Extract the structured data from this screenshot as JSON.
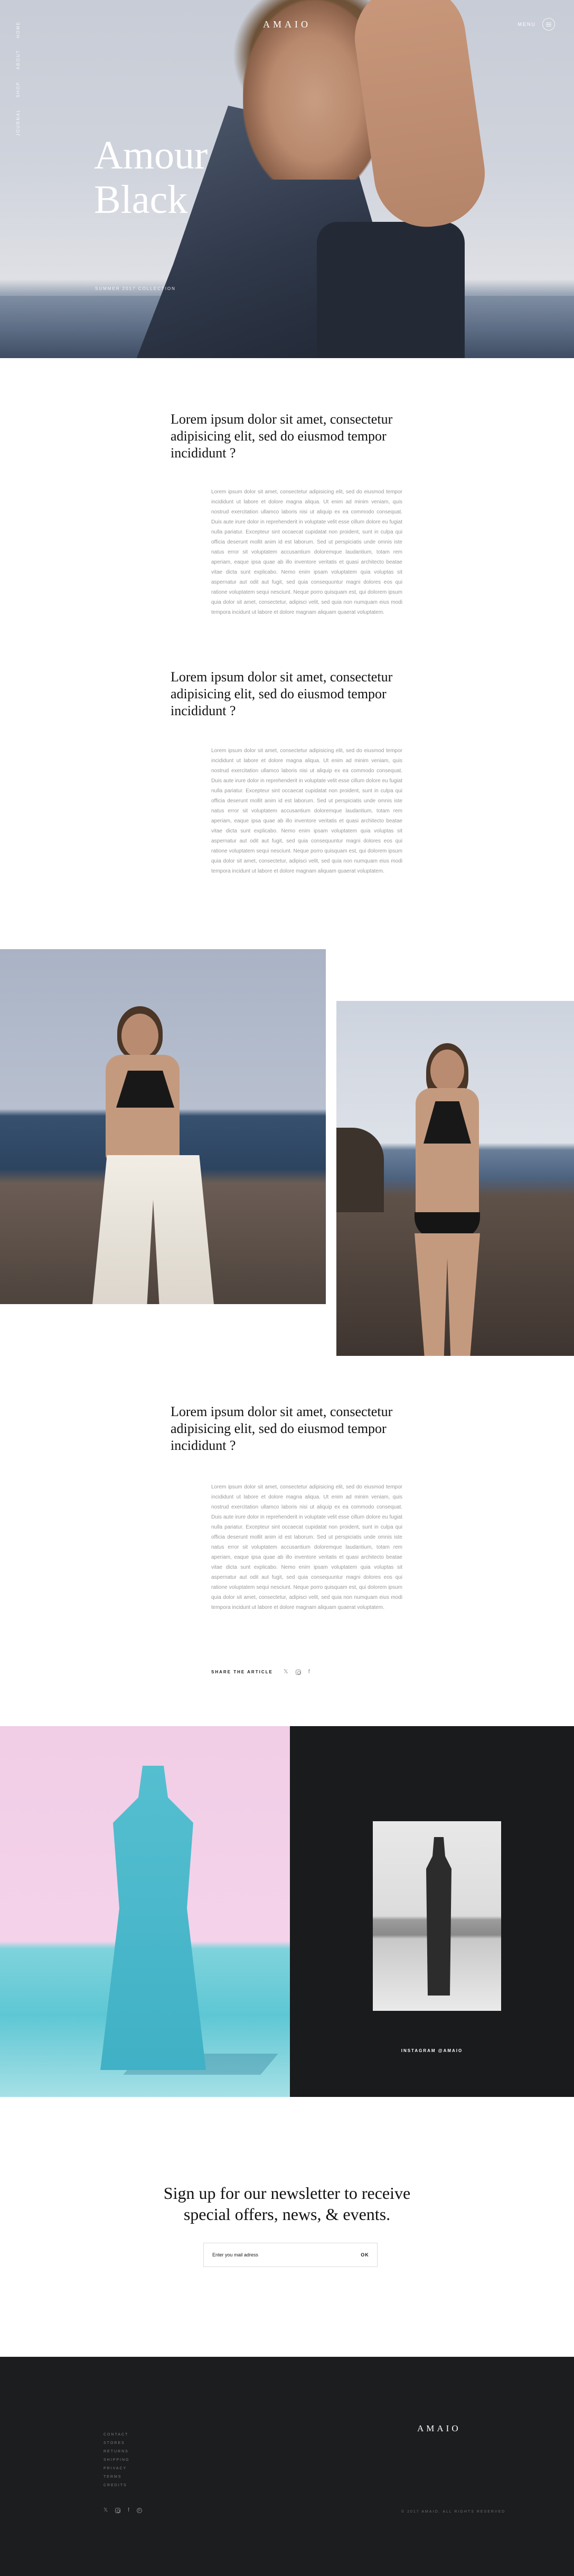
{
  "brand": "AMAIO",
  "header": {
    "menu_label": "MENU",
    "side_nav": [
      "HOME",
      "ABOUT",
      "SHOP",
      "JOURNAL"
    ]
  },
  "hero": {
    "title_line1": "Amour",
    "title_line2": "Black",
    "caption": "SUMMER 2017 COLLECTION"
  },
  "article": {
    "sections": [
      {
        "heading": "Lorem ipsum dolor sit amet, consectetur adipisicing elit, sed do eiusmod tempor incididunt ?",
        "body": "Lorem ipsum dolor sit amet, consectetur adipisicing elit, sed do eiusmod tempor incididunt ut labore et dolore magna aliqua. Ut enim ad minim veniam, quis nostrud exercitation ullamco laboris nisi ut aliquip ex ea commodo consequat. Duis aute irure dolor in reprehenderit in voluptate velit esse cillum dolore eu fugiat nulla pariatur. Excepteur sint occaecat cupidatat non proident, sunt in culpa qui officia deserunt mollit anim id est laborum. Sed ut perspiciatis unde omnis iste natus error sit voluptatem accusantium doloremque laudantium, totam rem aperiam, eaque ipsa quae ab illo inventore veritatis et quasi architecto beatae vitae dicta sunt explicabo. Nemo enim ipsam voluptatem quia voluptas sit aspernatur aut odit aut fugit, sed quia consequuntur magni dolores eos qui ratione voluptatem sequi nesciunt. Neque porro quisquam est, qui dolorem ipsum quia dolor sit amet, consectetur, adipisci velit, sed quia non numquam eius modi tempora incidunt ut labore et dolore magnam aliquam quaerat voluptatem."
      },
      {
        "heading": "Lorem ipsum dolor sit amet, consectetur adipisicing elit, sed do eiusmod tempor incididunt ?",
        "body": "Lorem ipsum dolor sit amet, consectetur adipisicing elit, sed do eiusmod tempor incididunt ut labore et dolore magna aliqua. Ut enim ad minim veniam, quis nostrud exercitation ullamco laboris nisi ut aliquip ex ea commodo consequat. Duis aute irure dolor in reprehenderit in voluptate velit esse cillum dolore eu fugiat nulla pariatur. Excepteur sint occaecat cupidatat non proident, sunt in culpa qui officia deserunt mollit anim id est laborum. Sed ut perspiciatis unde omnis iste natus error sit voluptatem accusantium doloremque laudantium, totam rem aperiam, eaque ipsa quae ab illo inventore veritatis et quasi architecto beatae vitae dicta sunt explicabo. Nemo enim ipsam voluptatem quia voluptas sit aspernatur aut odit aut fugit, sed quia consequuntur magni dolores eos qui ratione voluptatem sequi nesciunt. Neque porro quisquam est, qui dolorem ipsum quia dolor sit amet, consectetur, adipisci velit, sed quia non numquam eius modi tempora incidunt ut labore et dolore magnam aliquam quaerat voluptatem."
      },
      {
        "heading": "Lorem ipsum dolor sit amet, consectetur adipisicing elit, sed do eiusmod tempor incididunt ?",
        "body": "Lorem ipsum dolor sit amet, consectetur adipisicing elit, sed do eiusmod tempor incididunt ut labore et dolore magna aliqua. Ut enim ad minim veniam, quis nostrud exercitation ullamco laboris nisi ut aliquip ex ea commodo consequat. Duis aute irure dolor in reprehenderit in voluptate velit esse cillum dolore eu fugiat nulla pariatur. Excepteur sint occaecat cupidatat non proident, sunt in culpa qui officia deserunt mollit anim id est laborum. Sed ut perspiciatis unde omnis iste natus error sit voluptatem accusantium doloremque laudantium, totam rem aperiam, eaque ipsa quae ab illo inventore veritatis et quasi architecto beatae vitae dicta sunt explicabo. Nemo enim ipsam voluptatem quia voluptas sit aspernatur aut odit aut fugit, sed quia consequuntur magni dolores eos qui ratione voluptatem sequi nesciunt. Neque porro quisquam est, qui dolorem ipsum quia dolor sit amet, consectetur, adipisci velit, sed quia non numquam eius modi tempora incidunt ut labore et dolore magnam aliquam quaerat voluptatem."
      }
    ],
    "share_label": "SHARE THE ARTICLE",
    "share_icons": [
      "twitter-icon",
      "instagram-icon",
      "facebook-icon"
    ]
  },
  "feature": {
    "instagram_link": "INSTAGRAM @AMAIO"
  },
  "newsletter": {
    "heading_line1": "Sign up for our newsletter to receive",
    "heading_line2": "special offers, news, & events.",
    "placeholder": "Enter you mail adress",
    "submit_label": "OK"
  },
  "footer": {
    "brand": "AMAIO",
    "nav": [
      "CONTACT",
      "STORES",
      "RETURNS",
      "SHIPPING",
      "PRIVACY",
      "TERMS",
      "CREDITS"
    ],
    "social_icons": [
      "twitter-icon",
      "instagram-icon",
      "facebook-icon",
      "pinterest-icon"
    ],
    "copyright": "© 2017 AMAIO. ALL RIGHTS RESERVED"
  },
  "colors": {
    "accent_dark": "#1c1d1e",
    "heading": "#111111",
    "body_text": "#9a9a9a",
    "feature_pink": "#f1cde6",
    "feature_teal": "#55bfd0"
  }
}
